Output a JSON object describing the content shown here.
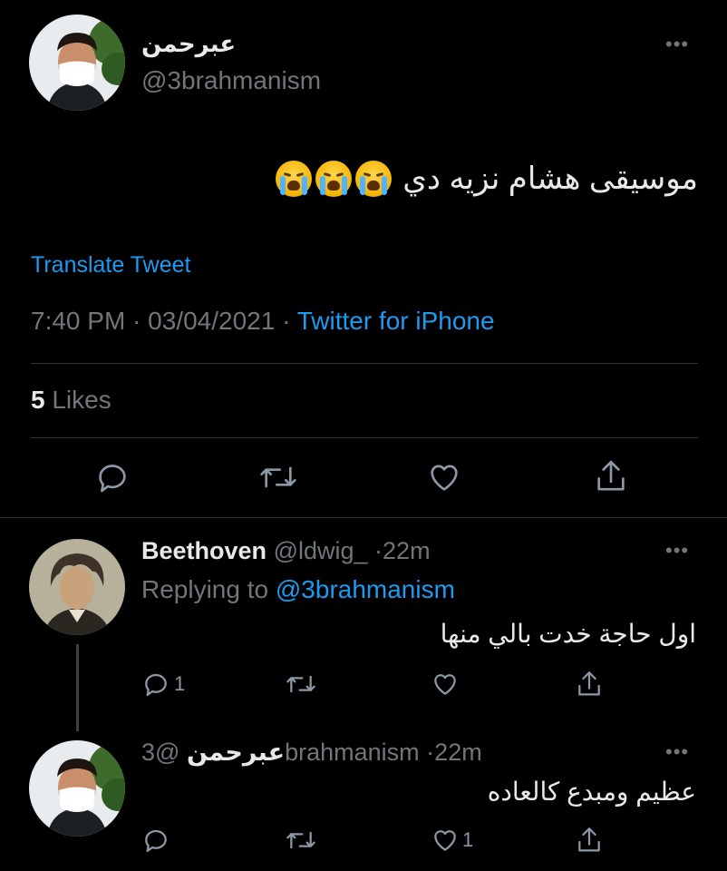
{
  "main_tweet": {
    "display_name": "عبرحمن",
    "handle": "@3brahmanism",
    "text": "موسيقى هشام نزيه دي",
    "emoji": [
      "loudly-crying-face",
      "loudly-crying-face",
      "loudly-crying-face"
    ],
    "translate_label": "Translate Tweet",
    "time": "7:40 PM",
    "date": "03/04/2021",
    "separator": "·",
    "source": "Twitter for iPhone",
    "likes_count": "5",
    "likes_label": "Likes",
    "more": "•••"
  },
  "replies": [
    {
      "display_name": "Beethoven",
      "handle": "@ldwig_",
      "age": "22m",
      "separator": "·",
      "replying_prefix": "Replying to",
      "replying_to": "@3brahmanism",
      "text": "اول حاجة خدت بالي منها",
      "reply_count": "1",
      "like_count": "",
      "more": "•••"
    },
    {
      "display_name": "عبرحمن",
      "handle": "@3brahmanism",
      "age": "22m",
      "separator": "·",
      "text": "عظيم ومبدع كالعاده",
      "reply_count": "",
      "like_count": "1",
      "more": "•••"
    }
  ],
  "colors": {
    "background": "#000000",
    "accent": "#1d9bf0",
    "muted": "#71767b",
    "divider": "#2f3336"
  }
}
